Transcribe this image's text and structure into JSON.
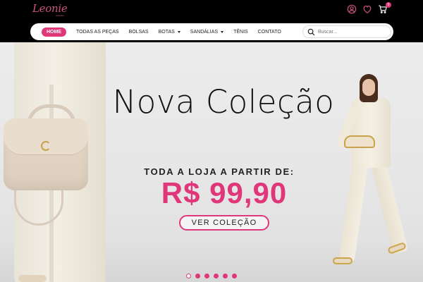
{
  "brand": {
    "logo": "Leonie",
    "logo_sub": "calçados"
  },
  "header_icons": [
    {
      "name": "user-icon"
    },
    {
      "name": "heart-icon"
    },
    {
      "name": "cart-icon",
      "badge": "0"
    }
  ],
  "nav": {
    "items": [
      {
        "label": "HOME",
        "active": true
      },
      {
        "label": "TODAS AS PEÇAS"
      },
      {
        "label": "BOLSAS"
      },
      {
        "label": "BOTAS",
        "dropdown": true
      },
      {
        "label": "SANDÁLIAS",
        "dropdown": true
      },
      {
        "label": "TÊNIS"
      },
      {
        "label": "CONTATO"
      }
    ],
    "search_placeholder": "Buscar..."
  },
  "hero": {
    "title": "Nova Coleção",
    "subtitle": "TODA A  LOJA A PARTIR DE:",
    "price": "R$ 99,90",
    "cta": "VER COLEÇÃO"
  },
  "carousel": {
    "slides": 6,
    "active_index": 0
  },
  "colors": {
    "brand_pink": "#e0377b",
    "logo_pink": "#c8527e",
    "header_bg": "#000000"
  }
}
